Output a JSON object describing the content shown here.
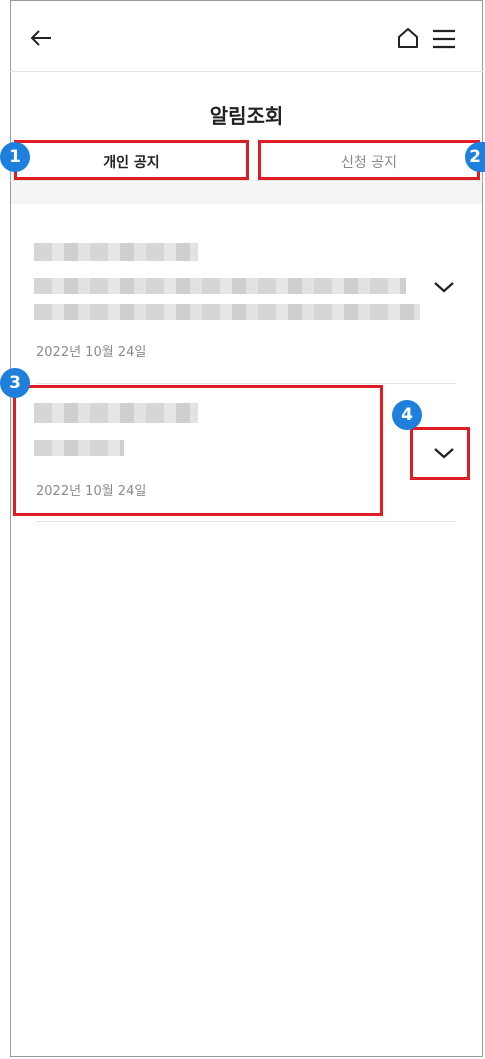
{
  "header": {
    "back_icon": "arrow-left-icon",
    "home_icon": "home-icon",
    "menu_icon": "hamburger-menu-icon"
  },
  "page": {
    "title": "알림조회"
  },
  "tabs": [
    {
      "label": "개인 공지",
      "active": true
    },
    {
      "label": "신청 공지",
      "active": false
    }
  ],
  "notices": [
    {
      "date": "2022년 10월 24일",
      "expanded": false
    },
    {
      "date": "2022년 10월 24일",
      "expanded": false
    }
  ],
  "annotations": {
    "badge1": "1",
    "badge2": "2",
    "badge3": "3",
    "badge4": "4"
  },
  "colors": {
    "annotation_box": "#e01c24",
    "annotation_badge": "#1e7fdc"
  }
}
